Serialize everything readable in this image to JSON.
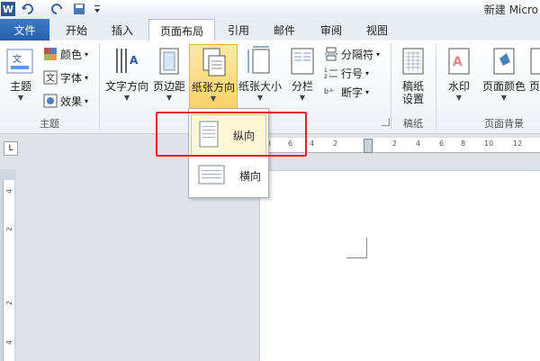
{
  "title_bar": {
    "app_icon": "W",
    "document_title": "新建 Micro",
    "quick_access": [
      "undo-icon",
      "redo-icon",
      "save-icon",
      "customize-icon"
    ]
  },
  "tabs": {
    "file": "文件",
    "items": [
      "开始",
      "插入",
      "页面布局",
      "引用",
      "邮件",
      "审阅",
      "视图"
    ],
    "active": "页面布局"
  },
  "ribbon": {
    "theme_group": {
      "label": "主题",
      "themes": "主题",
      "colors": "颜色",
      "fonts": "字体",
      "effects": "效果"
    },
    "page_setup": {
      "text_direction": "文字方向",
      "margins": "页边距",
      "orientation": "纸张方向",
      "size": "纸张大小",
      "columns": "分栏",
      "breaks": "分隔符",
      "line_numbers": "行号",
      "hyphenation": "断字"
    },
    "manuscript_group": {
      "label": "稿纸",
      "button": "稿纸\n设置",
      "line1": "稿纸",
      "line2": "设置"
    },
    "page_background": {
      "label": "页面背景",
      "watermark": "水印",
      "page_color": "页面颜色",
      "border_partial": "页"
    }
  },
  "orientation_menu": {
    "items": [
      {
        "label": "纵向",
        "selected": true
      },
      {
        "label": "横向",
        "selected": false
      }
    ]
  },
  "ruler": {
    "horizontal_ticks": [
      "8",
      "6",
      "4",
      "2",
      "2",
      "4",
      "6",
      "8",
      "10",
      "12"
    ],
    "vertical_ticks": [
      "4",
      "2",
      "2",
      "4"
    ]
  },
  "colors": {
    "file_tab": "#2560ad",
    "highlight": "#f9cf62",
    "annotation": "#e02424"
  }
}
